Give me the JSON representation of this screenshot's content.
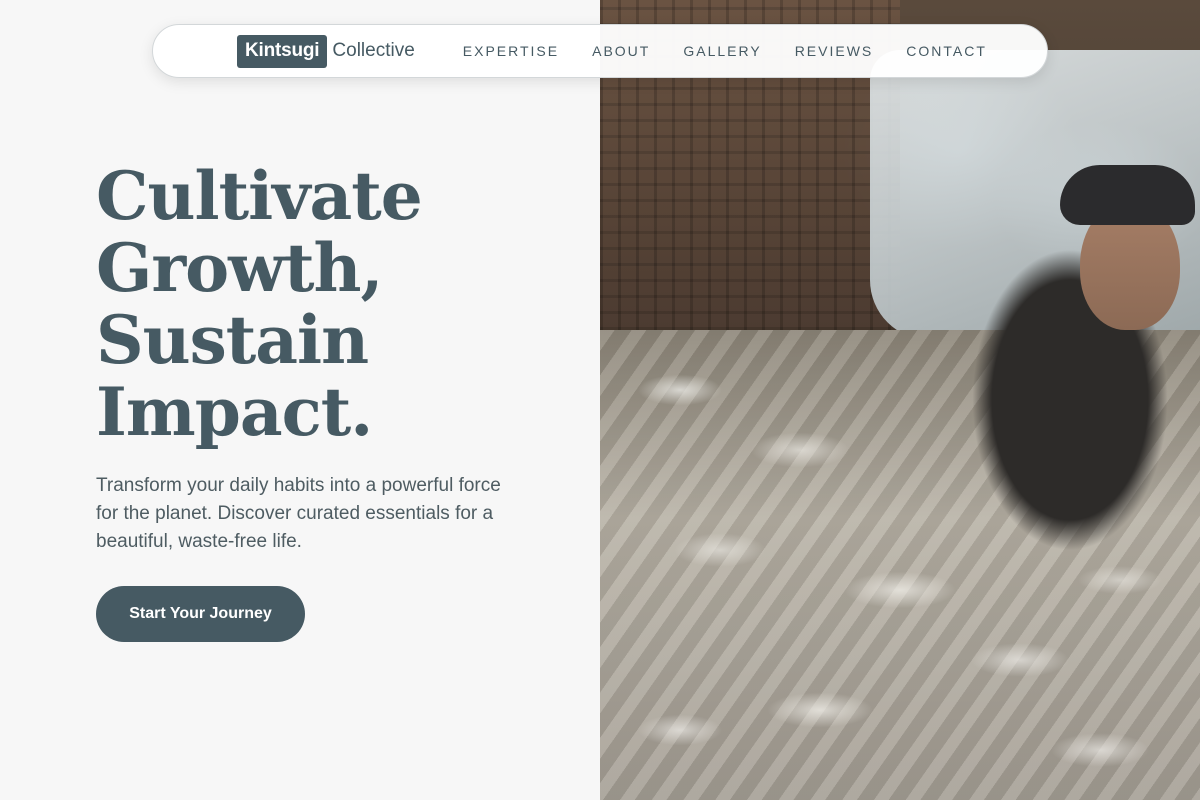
{
  "brand": {
    "highlight": "Kintsugi",
    "rest": "Collective"
  },
  "nav": {
    "items": [
      "EXPERTISE",
      "ABOUT",
      "GALLERY",
      "REVIEWS",
      "CONTACT"
    ]
  },
  "hero": {
    "title_lines": [
      "Cultivate",
      "Growth,",
      "Sustain",
      "Impact."
    ],
    "subtitle": "Transform your daily habits into a powerful force for the planet. Discover curated essentials for a beautiful, waste-free life.",
    "cta_label": "Start Your Journey",
    "image_description": "photo-man-sorting-plastic-bottles"
  },
  "colors": {
    "accent": "#465a63",
    "background": "#f7f7f7",
    "button_text": "#ffffff"
  }
}
